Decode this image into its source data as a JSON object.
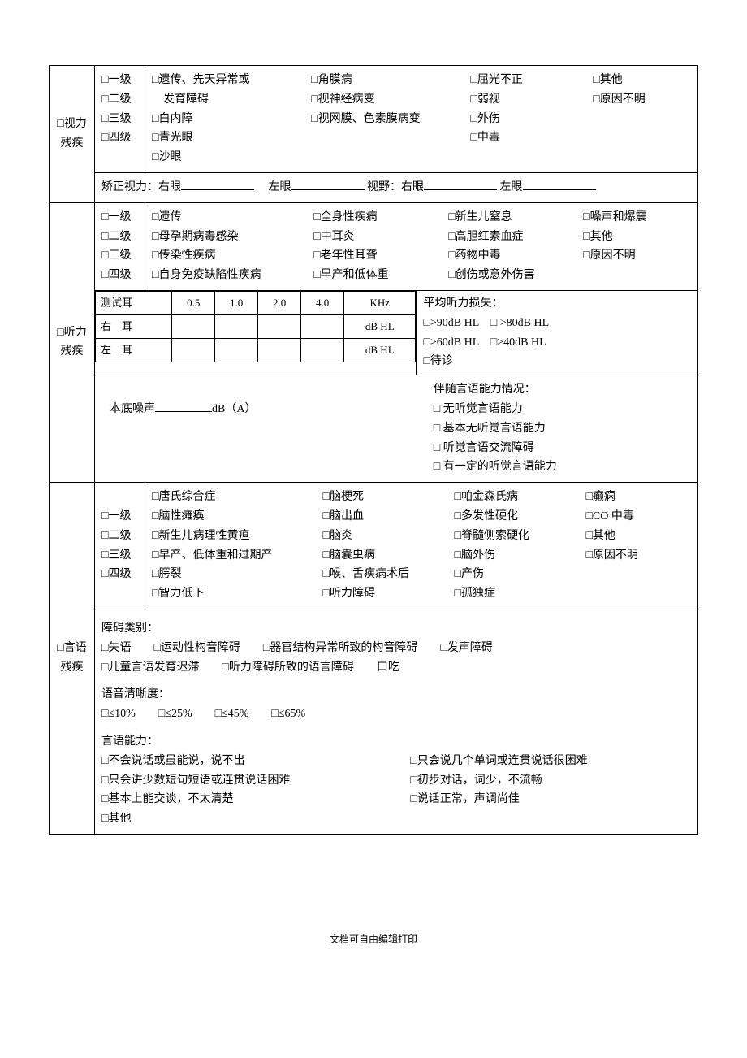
{
  "sections": {
    "vision": {
      "label_l1": "□视力",
      "label_l2": "残疾",
      "levels": [
        "□一级",
        "□二级",
        "□三级",
        "□四级"
      ],
      "causes_c1": [
        "□遗传、先天异常或",
        "　发育障碍",
        "□白内障",
        "□青光眼",
        "□沙眼"
      ],
      "causes_c2": [
        "□角膜病",
        "□视神经病变",
        "□视网膜、色素膜病变"
      ],
      "causes_c3": [
        "□屈光不正",
        "□弱视",
        "□外伤",
        "□中毒"
      ],
      "causes_c4": [
        "□其他",
        "□原因不明"
      ],
      "correct_prefix": "矫正视力：右眼",
      "left_eye": "左眼",
      "field_prefix": "视野：右眼",
      "left_eye2": "左眼"
    },
    "hearing": {
      "label_l1": "□听力",
      "label_l2": "残疾",
      "levels": [
        "□一级",
        "□二级",
        "□三级",
        "□四级"
      ],
      "causes_c1": [
        "□遗传",
        "□母孕期病毒感染",
        "□传染性疾病",
        "□自身免疫缺陷性疾病"
      ],
      "causes_c2": [
        "□全身性疾病",
        "□中耳炎",
        "□老年性耳聋",
        "□早产和低体重"
      ],
      "causes_c3": [
        "□新生儿窒息",
        "□高胆红素血症",
        "□药物中毒",
        "□创伤或意外伤害"
      ],
      "causes_c4": [
        "□噪声和爆震",
        "□其他",
        "□原因不明"
      ],
      "test_ear": "测试耳",
      "freq": [
        "0.5",
        "1.0",
        "2.0",
        "4.0",
        "KHz"
      ],
      "right_ear": "右　耳",
      "left_ear": "左　耳",
      "dbhl": "dB HL",
      "avg_loss_title": "平均听力损失：",
      "avg_opts_l1": "□>90dB HL　□ >80dB HL",
      "avg_opts_l2": "□>60dB HL　□>40dB HL",
      "pending": "□待诊",
      "noise_prefix": "本底噪声",
      "noise_unit": "dB（A）",
      "lang_title": "伴随言语能力情况：",
      "lang_opts": [
        "□ 无听觉言语能力",
        "□ 基本无听觉言语能力",
        "□ 听觉言语交流障碍",
        "□ 有一定的听觉言语能力"
      ]
    },
    "speech": {
      "label_l1": "□言语",
      "label_l2": "残疾",
      "levels": [
        "□一级",
        "□二级",
        "□三级",
        "□四级"
      ],
      "causes_c1": [
        "□唐氏综合症",
        "□脑性瘫痪",
        "□新生儿病理性黄疸",
        "□早产、低体重和过期产",
        "□腭裂",
        "□智力低下"
      ],
      "causes_c2": [
        "□脑梗死",
        "□脑出血",
        "□脑炎",
        "□脑囊虫病",
        "□喉、舌疾病术后",
        "□听力障碍"
      ],
      "causes_c3": [
        "□帕金森氏病",
        "□多发性硬化",
        "□脊髓侧索硬化",
        "□脑外伤",
        "□产伤",
        "□孤独症"
      ],
      "causes_c4": [
        "□癫痫",
        "□CO 中毒",
        "□其他",
        "□原因不明"
      ],
      "barrier_title": "障碍类别：",
      "barrier_l1": "□失语　　□运动性构音障碍　　□器官结构异常所致的构音障碍　　□发声障碍",
      "barrier_l2": "□儿童言语发育迟滞　　□听力障碍所致的语言障碍　　口吃",
      "clarity_title": "语音清晰度：",
      "clarity_opts": "□≤10%　　□≤25%　　□≤45%　　□≤65%",
      "ability_title": "言语能力：",
      "ability_rows": [
        [
          "□不会说话或虽能说，说不出",
          "□只会说几个单词或连贯说话很困难"
        ],
        [
          "□只会讲少数短句短语或连贯说话困难",
          "□初步对话，词少，不流畅"
        ],
        [
          "□基本上能交谈，不太清楚",
          "□说话正常，声调尚佳"
        ],
        [
          "□其他",
          ""
        ]
      ]
    }
  },
  "footer": "文档可自由编辑打印"
}
